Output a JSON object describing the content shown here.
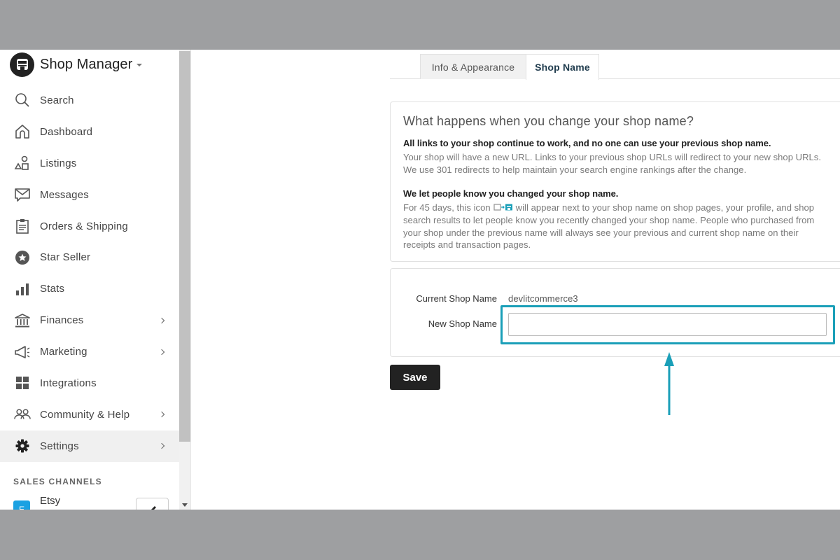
{
  "sidebar": {
    "brand_title": "Shop Manager",
    "items": [
      {
        "label": "Search",
        "icon": "search-icon",
        "has_chevron": false
      },
      {
        "label": "Dashboard",
        "icon": "home-icon",
        "has_chevron": false
      },
      {
        "label": "Listings",
        "icon": "shapes-icon",
        "has_chevron": false
      },
      {
        "label": "Messages",
        "icon": "envelope-icon",
        "has_chevron": false
      },
      {
        "label": "Orders & Shipping",
        "icon": "clipboard-icon",
        "has_chevron": false
      },
      {
        "label": "Star Seller",
        "icon": "star-badge-icon",
        "has_chevron": false
      },
      {
        "label": "Stats",
        "icon": "bar-chart-icon",
        "has_chevron": false
      },
      {
        "label": "Finances",
        "icon": "bank-icon",
        "has_chevron": true
      },
      {
        "label": "Marketing",
        "icon": "megaphone-icon",
        "has_chevron": true
      },
      {
        "label": "Integrations",
        "icon": "grid-icon",
        "has_chevron": false
      },
      {
        "label": "Community & Help",
        "icon": "people-icon",
        "has_chevron": true
      },
      {
        "label": "Settings",
        "icon": "gear-icon",
        "has_chevron": true,
        "active": true
      }
    ],
    "sales_channels_header": "SALES CHANNELS",
    "sales_channels": [
      {
        "label": "Etsy",
        "badge": "E",
        "badge_color": "#1ba1e2"
      }
    ]
  },
  "tabs": [
    {
      "label": "Info & Appearance",
      "active": false
    },
    {
      "label": "Shop Name",
      "active": true
    }
  ],
  "info_card": {
    "title": "What happens when you change your shop name?",
    "section1_heading": "All links to your shop continue to work, and no one can use your previous shop name.",
    "section1_body": "Your shop will have a new URL. Links to your previous shop URLs will redirect to your new shop URLs. We use 301 redirects to help maintain your search engine rankings after the change.",
    "section2_heading": "We let people know you changed your shop name.",
    "section2_body_before_icon": "For 45 days, this icon",
    "section2_body_after_icon": "will appear next to your shop name on shop pages, your profile, and shop search results to let people know you recently changed your shop name. People who purchased from your shop under the previous name will always see your previous and current shop name on their receipts and transaction pages."
  },
  "form": {
    "current_label": "Current Shop Name",
    "current_value": "devlitcommerce3",
    "new_label": "New Shop Name",
    "new_value": "",
    "new_placeholder": ""
  },
  "save_label": "Save",
  "colors": {
    "highlight": "#1a9fb8",
    "button_bg": "#222222",
    "etsy_badge": "#1ba1e2"
  }
}
